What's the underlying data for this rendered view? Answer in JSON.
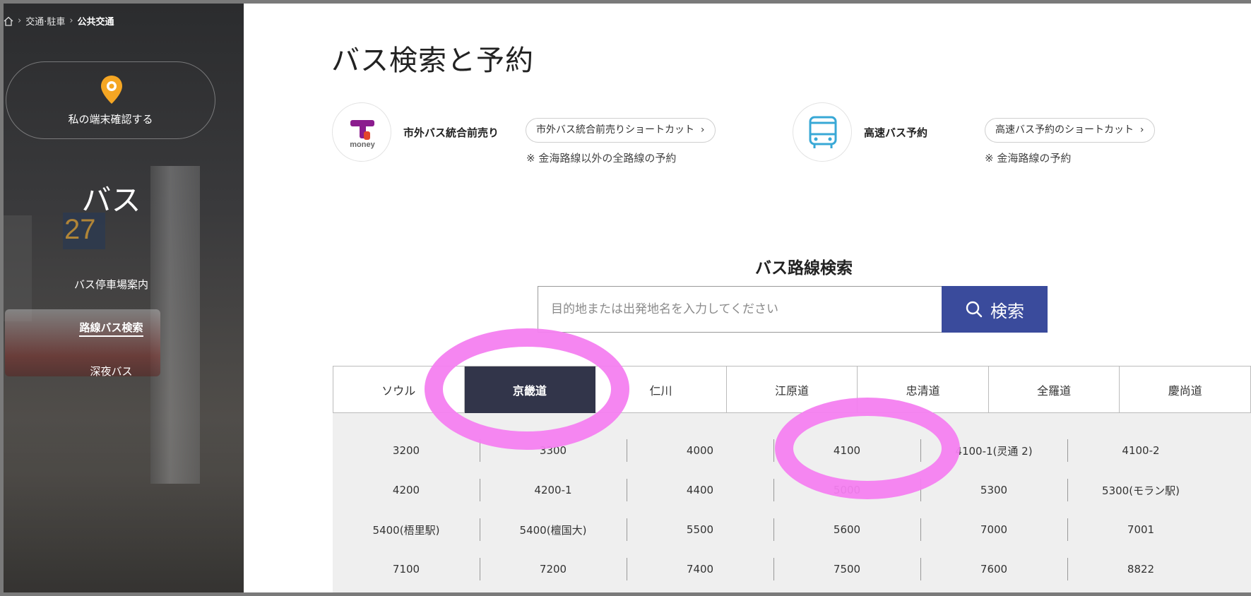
{
  "breadcrumb": {
    "items": [
      "交通·駐車",
      "公共交通"
    ]
  },
  "sidebar": {
    "device_button": "私の端末確認する",
    "title": "バス",
    "items": [
      {
        "label": "バス停車場案内",
        "active": false
      },
      {
        "label": "路線バス検索",
        "active": true
      },
      {
        "label": "深夜バス",
        "active": false
      }
    ]
  },
  "main": {
    "title": "バス検索と予約",
    "services": [
      {
        "name": "市外バス統合前売り",
        "shortcut": "市外バス統合前売りショートカット",
        "note": "※ 金海路線以外の全路線の予約",
        "logo": "tmoney-logo"
      },
      {
        "name": "高速バス予約",
        "shortcut": "高速バス予約のショートカット",
        "note": "※ 金海路線の予約",
        "logo": "bus-icon"
      }
    ],
    "route_search": {
      "title": "バス路線検索",
      "placeholder": "目的地または出発地名を入力してください",
      "button": "検索"
    },
    "tabs": [
      "ソウル",
      "京畿道",
      "仁川",
      "江原道",
      "忠清道",
      "全羅道",
      "慶尚道"
    ],
    "active_tab": "京畿道",
    "routes": [
      [
        "3200",
        "3300",
        "4000",
        "4100",
        "4100-1(灵通 2)",
        "4100-2"
      ],
      [
        "4200",
        "4200-1",
        "4400",
        "5000",
        "5300",
        "5300(モラン駅)"
      ],
      [
        "5400(梧里駅)",
        "5400(檀国大)",
        "5500",
        "5600",
        "7000",
        "7001"
      ],
      [
        "7100",
        "7200",
        "7400",
        "7500",
        "7600",
        "8822"
      ]
    ]
  },
  "colors": {
    "accent": "#3a4b9c",
    "active_tab": "#32354a",
    "annotation": "#f47ff0",
    "pin": "#f5a623"
  }
}
